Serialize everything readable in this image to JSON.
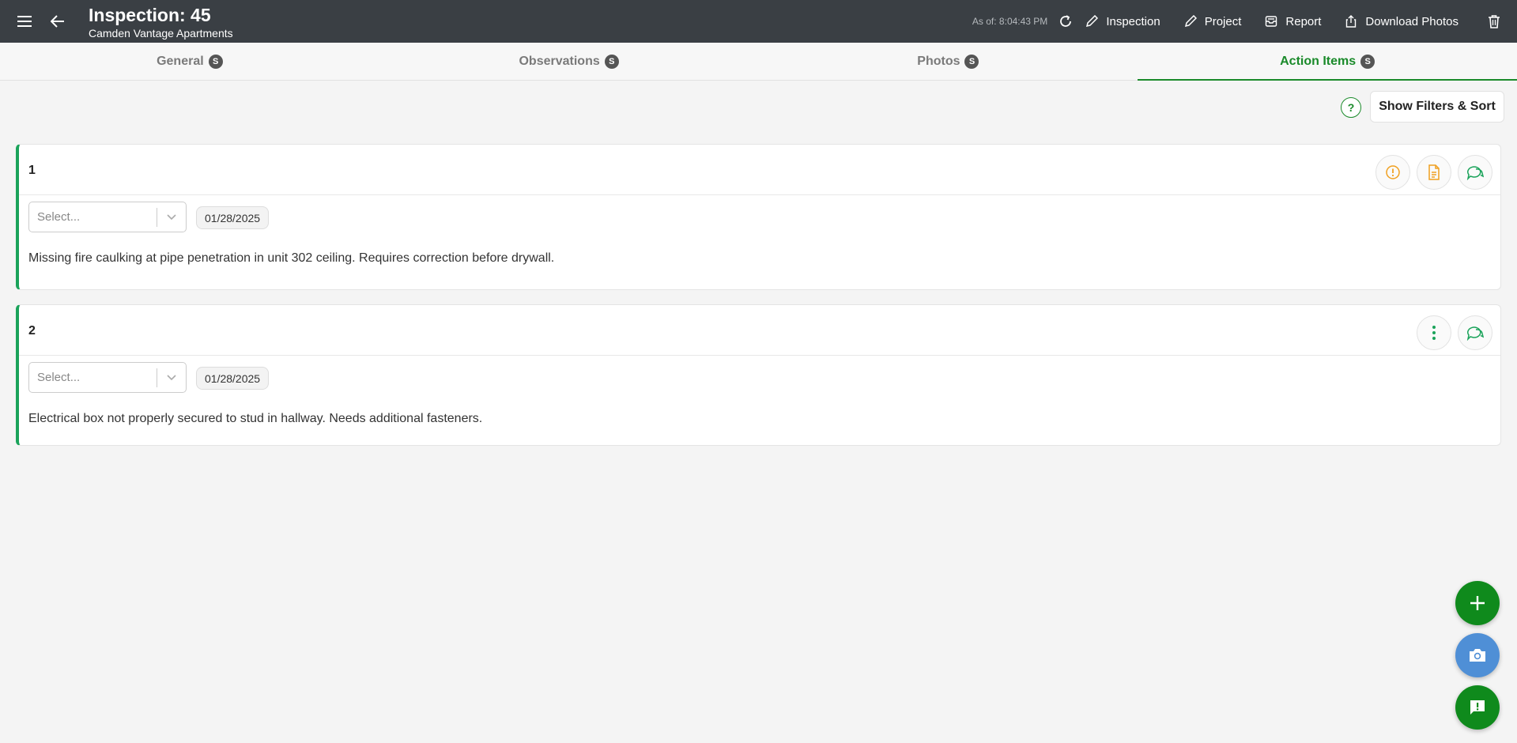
{
  "header": {
    "title": "Inspection: 45",
    "subtitle": "Camden Vantage Apartments",
    "as_of": "As of: 8:04:43 PM",
    "actions": {
      "inspection": "Inspection",
      "project": "Project",
      "report": "Report",
      "download_photos": "Download Photos"
    }
  },
  "tabs": [
    {
      "label": "General",
      "badge": "S"
    },
    {
      "label": "Observations",
      "badge": "S"
    },
    {
      "label": "Photos",
      "badge": "S"
    },
    {
      "label": "Action Items",
      "badge": "S",
      "active": true
    }
  ],
  "toolbar": {
    "help": "?",
    "filters_label": "Show Filters & Sort"
  },
  "action_items": [
    {
      "number": "1",
      "select_placeholder": "Select...",
      "date": "01/28/2025",
      "description": "Missing fire caulking at pipe penetration in unit 302 ceiling. Requires correction before drywall."
    },
    {
      "number": "2",
      "select_placeholder": "Select...",
      "date": "01/28/2025",
      "description": "Electrical box not properly secured to stud in hallway. Needs additional fasteners."
    }
  ],
  "colors": {
    "topbar": "#3a3f44",
    "accent_green": "#1a8a2a",
    "card_border": "#1aa35a",
    "warning_orange": "#f0a020",
    "camera_blue": "#4f8fd6"
  }
}
